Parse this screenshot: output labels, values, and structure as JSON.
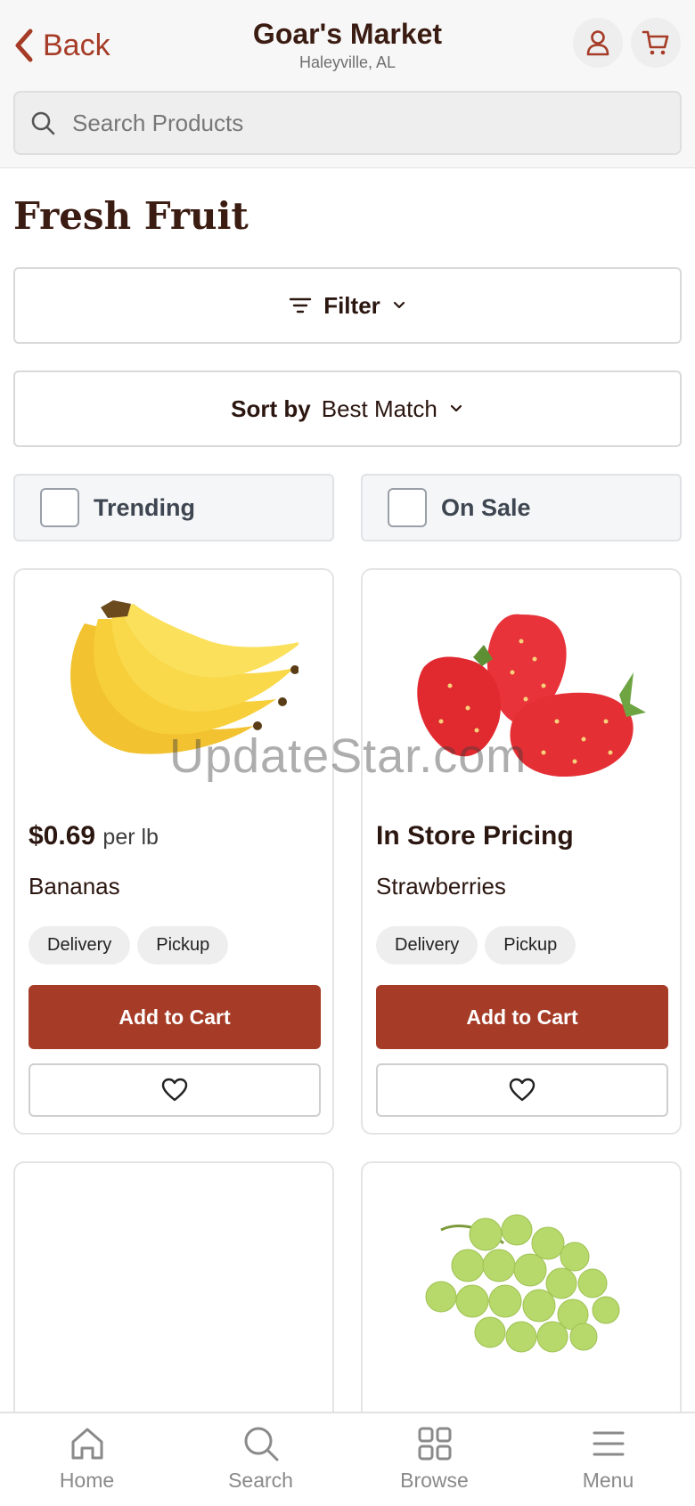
{
  "header": {
    "back_label": "Back",
    "store_name": "Goar's Market",
    "store_location": "Haleyville, AL",
    "search_placeholder": "Search Products"
  },
  "page": {
    "title": "Fresh Fruit",
    "filter_label": "Filter",
    "sort_label": "Sort by",
    "sort_value": "Best Match",
    "checkboxes": [
      {
        "label": "Trending",
        "checked": false
      },
      {
        "label": "On Sale",
        "checked": false
      }
    ]
  },
  "products": [
    {
      "price": "$0.69",
      "unit": "per lb",
      "name": "Bananas",
      "tags": [
        "Delivery",
        "Pickup"
      ],
      "add_label": "Add to Cart"
    },
    {
      "price": "In Store Pricing",
      "unit": "",
      "name": "Strawberries",
      "tags": [
        "Delivery",
        "Pickup"
      ],
      "add_label": "Add to Cart"
    }
  ],
  "watermark": "UpdateStar.com",
  "bottom_nav": [
    {
      "label": "Home",
      "icon": "home-icon"
    },
    {
      "label": "Search",
      "icon": "search-icon"
    },
    {
      "label": "Browse",
      "icon": "grid-icon"
    },
    {
      "label": "Menu",
      "icon": "menu-icon"
    }
  ],
  "colors": {
    "accent": "#a63c27",
    "title_brown": "#3b1c12"
  }
}
